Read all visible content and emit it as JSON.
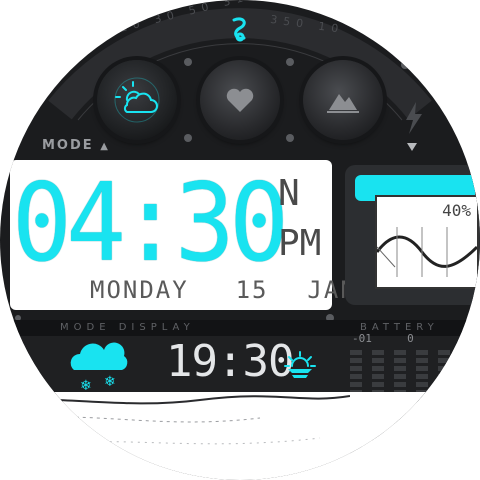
{
  "header": {
    "logo_icon": "swirl-logo-icon",
    "compass_ticks": [
      "10",
      "30",
      "50",
      "310",
      "340",
      "350",
      "10"
    ]
  },
  "dials": [
    {
      "name": "weather",
      "icon": "sun-cloud-icon",
      "active": true
    },
    {
      "name": "heart",
      "icon": "heart-icon",
      "active": false
    },
    {
      "name": "terrain",
      "icon": "mountain-icon",
      "active": false
    }
  ],
  "mode_label": "MODE",
  "main_time": "04:30",
  "seconds_glyph": "N",
  "ampm": "PM",
  "date": {
    "day": "MONDAY",
    "date_num": "15",
    "month": "JAN"
  },
  "side_panel": {
    "label": "40%"
  },
  "status_strip": {
    "left": "MODE DISPLAY",
    "right": "BATTERY"
  },
  "bottom": {
    "weather_icon": "cloud-snow-icon",
    "time2": "19:30",
    "sunset_icon": "sunset-icon",
    "scale_labels": [
      "-01",
      "0"
    ]
  },
  "colors": {
    "accent": "#19e3f0",
    "background": "#1b1c1e",
    "lcd": "#ffffff"
  }
}
